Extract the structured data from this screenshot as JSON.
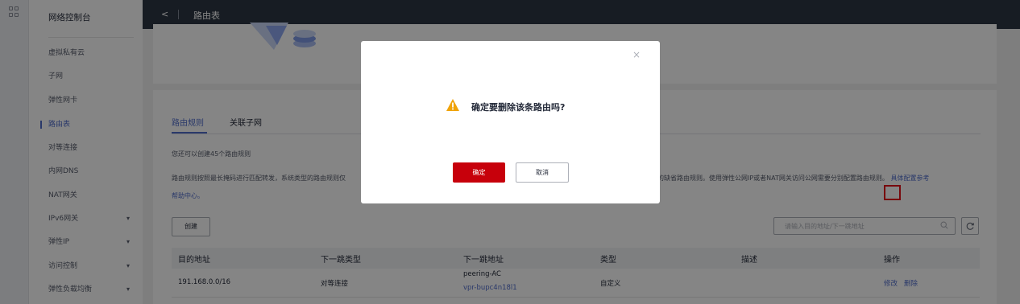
{
  "sidebar": {
    "title": "网络控制台",
    "items": [
      {
        "label": "虚拟私有云"
      },
      {
        "label": "子网"
      },
      {
        "label": "弹性网卡"
      },
      {
        "label": "路由表"
      },
      {
        "label": "对等连接"
      },
      {
        "label": "内网DNS"
      },
      {
        "label": "NAT网关"
      },
      {
        "label": "IPv6网关",
        "caret": "▾"
      },
      {
        "label": "弹性IP",
        "caret": "▾"
      },
      {
        "label": "访问控制",
        "caret": "▾"
      },
      {
        "label": "弹性负载均衡",
        "caret": "▾"
      }
    ],
    "active_item": "路由表",
    "collapse_glyph": "◂"
  },
  "header": {
    "back_glyph": "<",
    "title": "路由表"
  },
  "tabs": [
    {
      "label": "路由规则"
    },
    {
      "label": "关联子网"
    }
  ],
  "hint": "您还可以创建45个路由规则",
  "description": {
    "left": "路由规则按照最长掩码进行匹配转发，系统类型的路由规则仅",
    "right": "关的缺省路由规则。使用弹性公网IP或者NAT网关访问公网需要分别配置路由规则。",
    "link1": "具体配置参考",
    "link2": "帮助中心。"
  },
  "toolbar": {
    "create_label": "创建",
    "search_placeholder": "请输入目的地址/下一跳地址"
  },
  "table": {
    "headers": [
      "目的地址",
      "下一跳类型",
      "下一跳地址",
      "类型",
      "描述",
      "操作"
    ],
    "rows": [
      {
        "destination": "191.168.0.0/16",
        "next_hop_type": "对等连接",
        "next_hop_name": "peering-AC",
        "next_hop_id": "vpr-bupc4n18l1",
        "type": "自定义",
        "description": "",
        "action_modify": "修改",
        "action_delete": "删除"
      }
    ]
  },
  "dialog": {
    "message": "确定要删除该条路由吗?",
    "confirm_label": "确定",
    "cancel_label": "取消",
    "close_glyph": "×"
  },
  "colors": {
    "topbar": "#2c3643",
    "accent": "#526ecc",
    "confirm": "#c7000b",
    "warning": "#f0a30a",
    "highlight": "#e6101a"
  }
}
